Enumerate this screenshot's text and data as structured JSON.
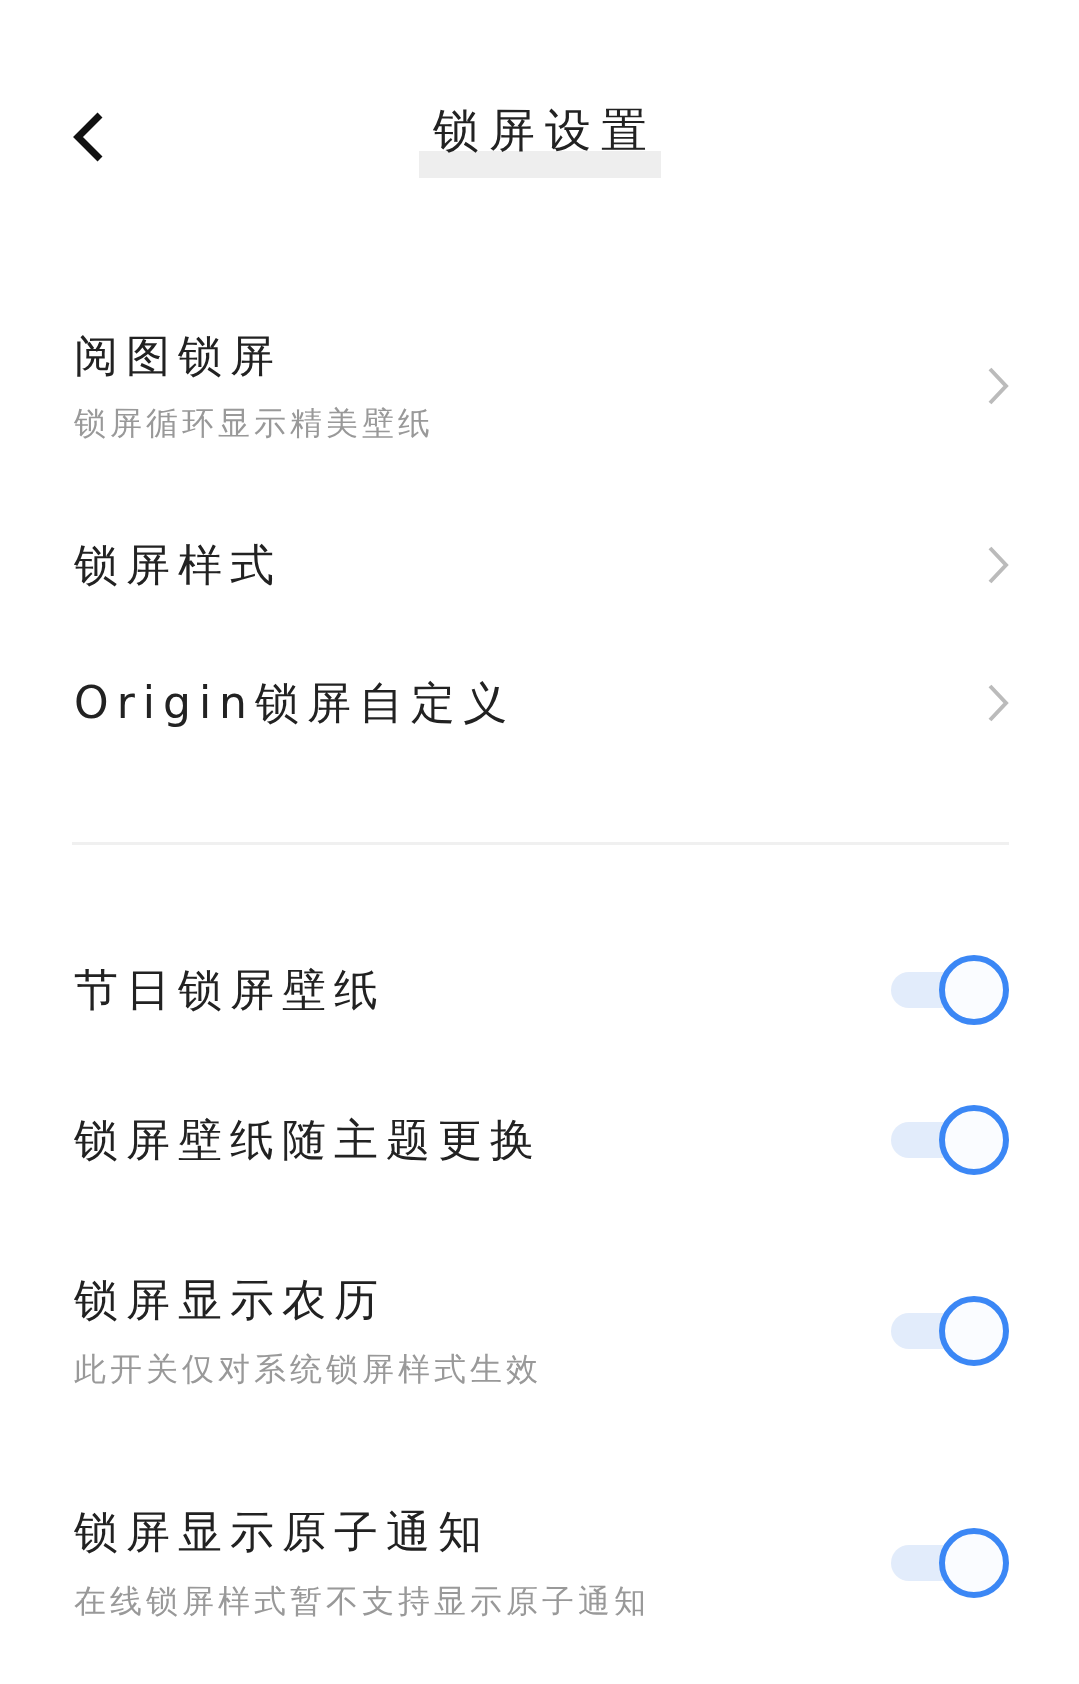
{
  "header": {
    "title": "锁屏设置"
  },
  "nav_items": [
    {
      "title": "阅图锁屏",
      "subtitle": "锁屏循环显示精美壁纸"
    },
    {
      "title": "锁屏样式"
    },
    {
      "title": "Origin锁屏自定义"
    }
  ],
  "toggle_items": [
    {
      "title": "节日锁屏壁纸",
      "on": true
    },
    {
      "title": "锁屏壁纸随主题更换",
      "on": true
    },
    {
      "title": "锁屏显示农历",
      "subtitle": "此开关仅对系统锁屏样式生效",
      "on": true
    },
    {
      "title": "锁屏显示原子通知",
      "subtitle": "在线锁屏样式暂不支持显示原子通知",
      "on": true
    }
  ]
}
